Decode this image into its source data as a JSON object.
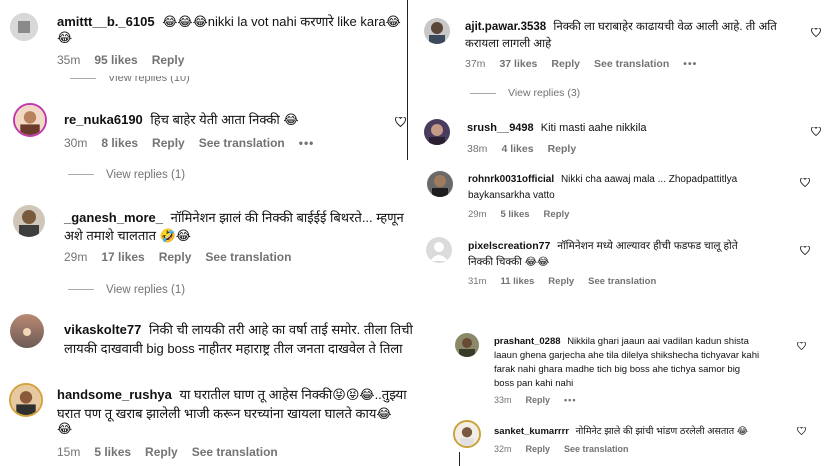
{
  "left": [
    {
      "user": "amittt__b._6105",
      "text": "😂😂😂nikki la vot nahi करणारे like kara😂",
      "text2": "😂",
      "time": "35m",
      "likes": "95 likes",
      "reply": "Reply",
      "translate": "",
      "replies": "View replies (10)"
    },
    {
      "user": "re_nuka6190",
      "text": "हिच बाहेर येती आता निक्की 😂",
      "time": "30m",
      "likes": "8 likes",
      "reply": "Reply",
      "translate": "See translation",
      "replies": "View replies (1)"
    },
    {
      "user": "_ganesh_more_",
      "text": "नॉमिनेशन झालं की निक्की बाईईई बिथरते... म्हणून",
      "text2": "अशे तमाशे चालतात 🤣😂",
      "time": "29m",
      "likes": "17 likes",
      "reply": "Reply",
      "translate": "See translation",
      "replies": "View replies (1)"
    },
    {
      "user": "vikaskolte77",
      "text": "निकी ची लायकी तरी आहे का वर्षा ताई समोर. तीला तिची",
      "text2": "लायकी दाखवावी big boss नाहीतर महाराष्ट्र तील जनता दाखवेल ते तिला",
      "time": "",
      "likes": "",
      "reply": "",
      "translate": "",
      "replies": ""
    },
    {
      "user": "handsome_rushya",
      "text": "या घरातील घाण तू आहेस निक्की😝😝😂..तुझ्या",
      "text2": "घरात पण तू खराब झालेली भाजी करून घरच्यांना खायला घालते काय😂",
      "text3": "😂",
      "time": "15m",
      "likes": "5 likes",
      "reply": "Reply",
      "translate": "See translation",
      "replies": ""
    }
  ],
  "right": [
    {
      "user": "ajit.pawar.3538",
      "text": "निक्की ला घराबाहेर काढायची वेळ आली आहे. ती अति",
      "text2": "करायला लागली आहे",
      "time": "37m",
      "likes": "37 likes",
      "reply": "Reply",
      "translate": "See translation",
      "replies": "View replies (3)"
    },
    {
      "user": "srush__9498",
      "text": "Kiti masti aahe nikkila",
      "time": "38m",
      "likes": "4 likes",
      "reply": "Reply"
    },
    {
      "user": "rohnrk0031official",
      "text": "Nikki cha aawaj mala ... Zhopadpattitlya",
      "text2": "baykansarkha vatto",
      "time": "29m",
      "likes": "5 likes",
      "reply": "Reply"
    },
    {
      "user": "pixelscreation77",
      "text": "नॉमिनेशन मध्ये आल्यावर हीची फडफड चालू होते",
      "text2": "निक्की चिक्की 😂😂",
      "time": "31m",
      "likes": "11 likes",
      "reply": "Reply",
      "translate": "See translation"
    }
  ],
  "bottom": [
    {
      "user": "prashant_0288",
      "text": "Nikkila ghari jaaun aai vadilan kadun shista",
      "text2": "laaun ghena garjecha ahe tila dilelya shikshecha tichyavar kahi",
      "text3": "farak nahi ghara madhe tich big boss ahe tichya samor big",
      "text4": "boss pan kahi nahi",
      "time": "33m",
      "reply": "Reply"
    },
    {
      "user": "sanket_kumarrrr",
      "text": "नोमिनेट झाले की झांची भांडण ठरलेली असतात 😂",
      "time": "32m",
      "reply": "Reply",
      "translate": "See translation"
    }
  ]
}
